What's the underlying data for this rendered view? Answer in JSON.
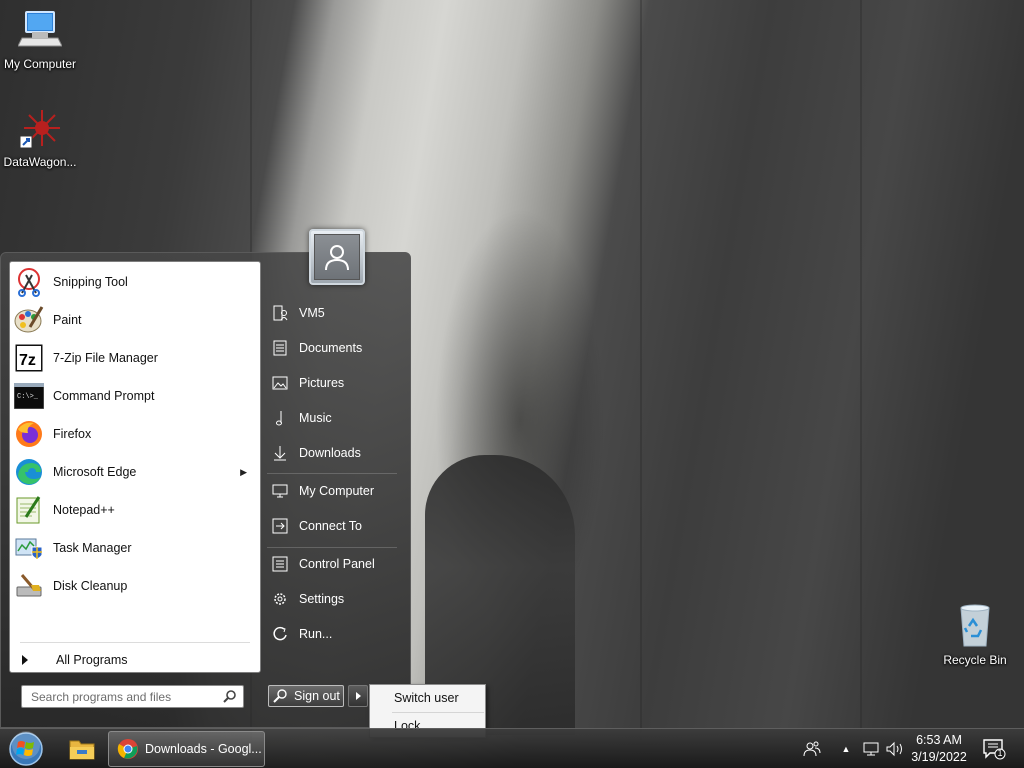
{
  "desktop": {
    "icons": [
      {
        "label": "My Computer"
      },
      {
        "label": "DataWagon..."
      },
      {
        "label": "Recycle Bin"
      }
    ]
  },
  "start_menu": {
    "programs": [
      {
        "label": "Snipping Tool",
        "icon": "snipping-tool-icon"
      },
      {
        "label": "Paint",
        "icon": "paint-icon"
      },
      {
        "label": "7-Zip File Manager",
        "icon": "7zip-icon"
      },
      {
        "label": "Command Prompt",
        "icon": "command-prompt-icon"
      },
      {
        "label": "Firefox",
        "icon": "firefox-icon"
      },
      {
        "label": "Microsoft Edge",
        "icon": "edge-icon",
        "has_submenu": true
      },
      {
        "label": "Notepad++",
        "icon": "notepadpp-icon"
      },
      {
        "label": "Task Manager",
        "icon": "task-manager-icon"
      },
      {
        "label": "Disk Cleanup",
        "icon": "disk-cleanup-icon"
      }
    ],
    "all_programs": "All Programs",
    "search_placeholder": "Search programs and files",
    "right_items": [
      {
        "label": "VM5",
        "icon": "user-folder-icon"
      },
      {
        "label": "Documents",
        "icon": "documents-icon"
      },
      {
        "label": "Pictures",
        "icon": "pictures-icon"
      },
      {
        "label": "Music",
        "icon": "music-icon"
      },
      {
        "label": "Downloads",
        "icon": "downloads-icon"
      },
      {
        "label": "My Computer",
        "icon": "computer-icon"
      },
      {
        "label": "Connect To",
        "icon": "connect-to-icon"
      },
      {
        "label": "Control Panel",
        "icon": "control-panel-icon"
      },
      {
        "label": "Settings",
        "icon": "settings-gear-icon"
      },
      {
        "label": "Run...",
        "icon": "run-icon"
      }
    ],
    "sign_out": "Sign out",
    "power_submenu": {
      "items": [
        {
          "label": "Switch user"
        },
        {
          "label": "Lock"
        }
      ]
    }
  },
  "taskbar": {
    "chrome_task": "Downloads - Googl...",
    "clock": {
      "time": "6:53 AM",
      "date": "3/19/2022"
    },
    "notification_count": "1"
  }
}
